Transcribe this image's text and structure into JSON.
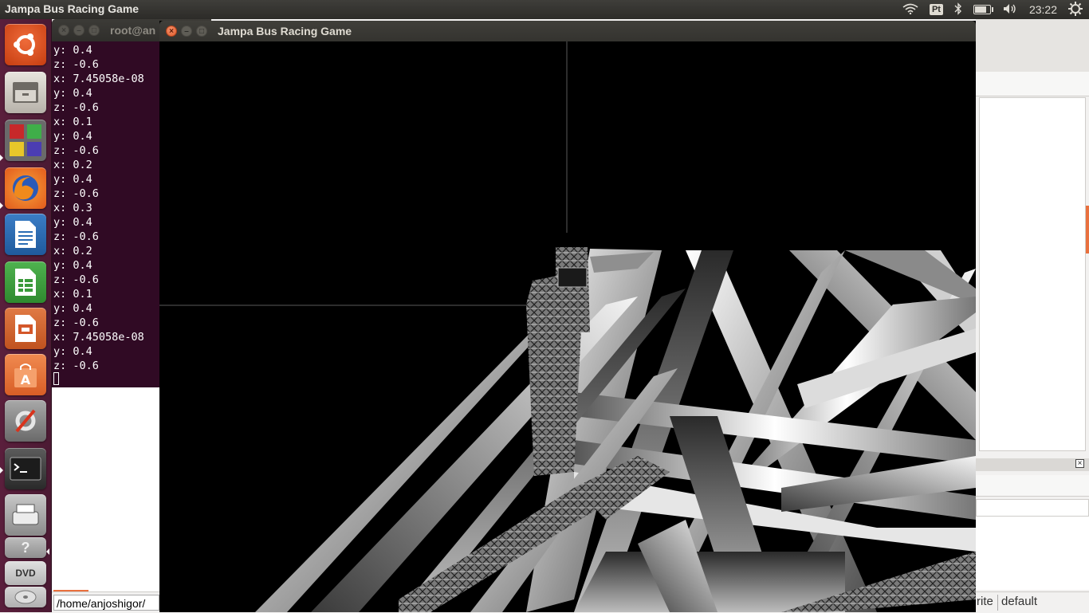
{
  "top_panel": {
    "app_title": "Jampa Bus Racing Game",
    "keyboard_layout": "Pt",
    "clock": "23:22",
    "icons": [
      "wifi-icon",
      "bluetooth-icon",
      "battery-icon",
      "volume-icon",
      "settings-gear-icon"
    ]
  },
  "launcher": {
    "items": [
      {
        "name": "ubuntu-dash",
        "color": "#dd4814"
      },
      {
        "name": "files",
        "color": "#c9c4bc"
      },
      {
        "name": "unknown-app",
        "color": "#3b8c3b"
      },
      {
        "name": "firefox",
        "color": "#e66000"
      },
      {
        "name": "libreoffice-writer",
        "color": "#2a6db5"
      },
      {
        "name": "libreoffice-calc",
        "color": "#3a9a3a"
      },
      {
        "name": "libreoffice-impress",
        "color": "#d4572a"
      },
      {
        "name": "ubuntu-software-center",
        "color": "#e9703e"
      },
      {
        "name": "system-settings",
        "color": "#8a8a8a"
      },
      {
        "name": "terminal",
        "color": "#2d2d2d"
      },
      {
        "name": "unknown-app-2",
        "color": "#9a9a9a"
      },
      {
        "name": "help",
        "color": "#aaaaaa"
      },
      {
        "name": "dvd",
        "color": "#cfcfcf"
      }
    ],
    "dvd_label": "DVD"
  },
  "terminal": {
    "title": "root@an",
    "lines": [
      "y: 0.4",
      "z: -0.6",
      "x: 7.45058e-08",
      "y: 0.4",
      "z: -0.6",
      "x: 0.1",
      "y: 0.4",
      "z: -0.6",
      "x: 0.2",
      "y: 0.4",
      "z: -0.6",
      "x: 0.3",
      "y: 0.4",
      "z: -0.6",
      "x: 0.2",
      "y: 0.4",
      "z: -0.6",
      "x: 0.1",
      "y: 0.4",
      "z: -0.6",
      "x: 7.45058e-08",
      "y: 0.4",
      "z: -0.6"
    ]
  },
  "game_window": {
    "title": "Jampa Bus Racing Game"
  },
  "status_bar": {
    "path": "/home/anjoshigor/",
    "mode_fragment": "rite",
    "profile": "default"
  }
}
